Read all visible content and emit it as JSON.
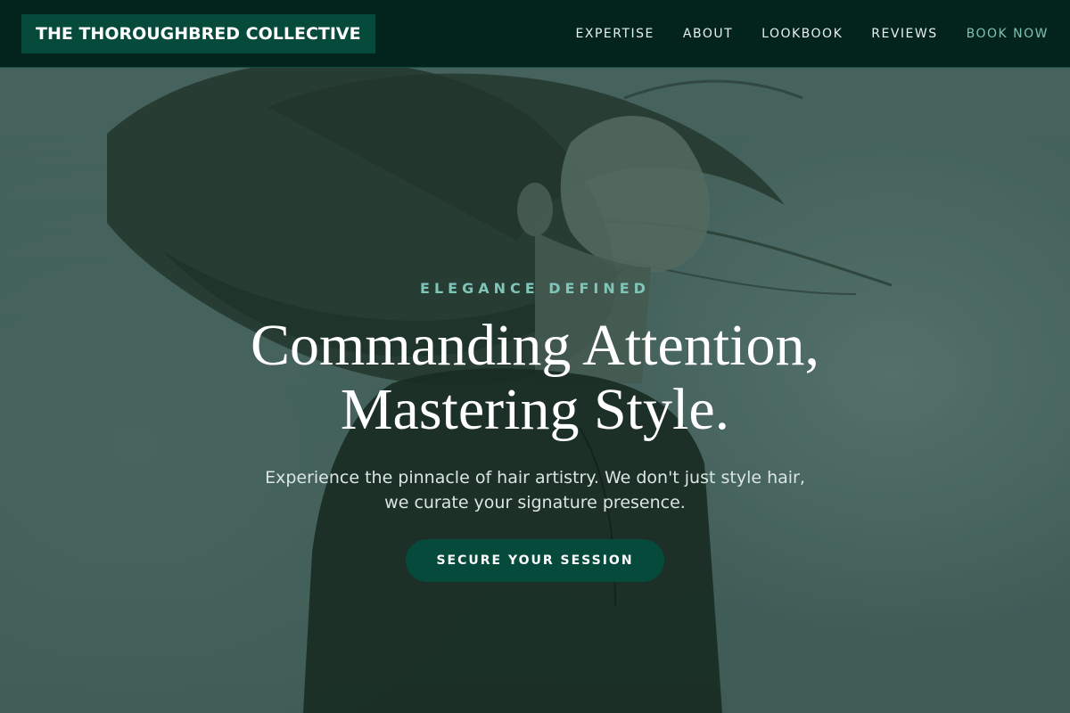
{
  "brand": {
    "name": "THE THOROUGHBRED COLLECTIVE",
    "color_bg": "#064a3c",
    "header_bg": "#03241d"
  },
  "nav": {
    "items": [
      {
        "label": "EXPERTISE"
      },
      {
        "label": "ABOUT"
      },
      {
        "label": "LOOKBOOK"
      },
      {
        "label": "REVIEWS"
      },
      {
        "label": "BOOK NOW",
        "accent": true
      }
    ],
    "accent_color": "#7fc1b2"
  },
  "hero": {
    "eyebrow": "ELEGANCE DEFINED",
    "headline_line1": "Commanding Attention,",
    "headline_line2": "Mastering Style.",
    "subtitle_line1": "Experience the pinnacle of hair artistry. We don't just style hair,",
    "subtitle_line2": "we curate your signature presence.",
    "cta_label": "SECURE YOUR SESSION",
    "background_image": "woman-with-flowing-hair-photo"
  }
}
